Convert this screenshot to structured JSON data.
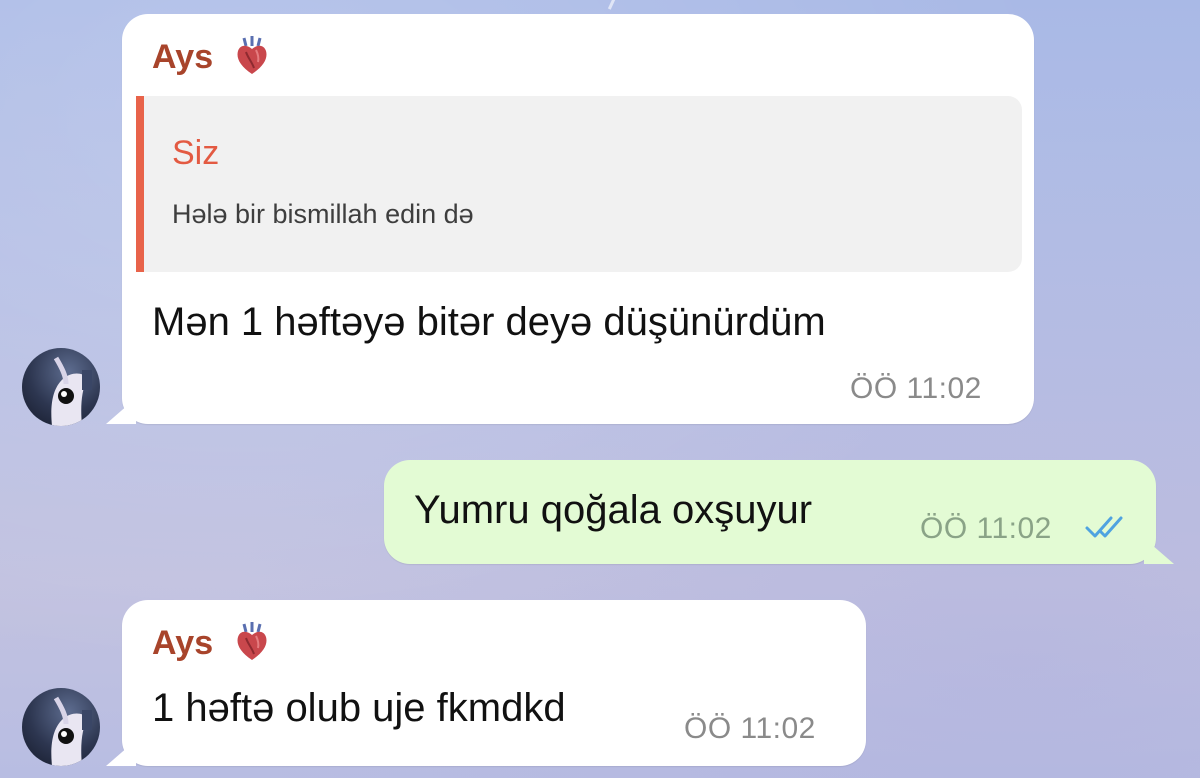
{
  "messages": [
    {
      "sender": "Ays",
      "reply": {
        "name": "Siz",
        "text": "Hələ bir bismillah edin də"
      },
      "text": "Mən 1 həftəyə bitər deyə düşünürdüm",
      "time": "ÖÖ 11:02"
    },
    {
      "text": "Yumru qoğala oxşuyur",
      "time": "ÖÖ 11:02",
      "status": "read-double-check"
    },
    {
      "sender": "Ays",
      "text": "1 həftə olub uje fkmdkd",
      "time": "ÖÖ 11:02"
    }
  ],
  "colors": {
    "incoming_bubble": "#ffffff",
    "outgoing_bubble": "#e3fbd4",
    "sender_name": "#a8442b",
    "reply_accent": "#e8634a",
    "check_marks": "#4fa3e0"
  },
  "icons": {
    "sender_badge": "anatomical-heart-icon",
    "read_status": "double-check-icon"
  }
}
